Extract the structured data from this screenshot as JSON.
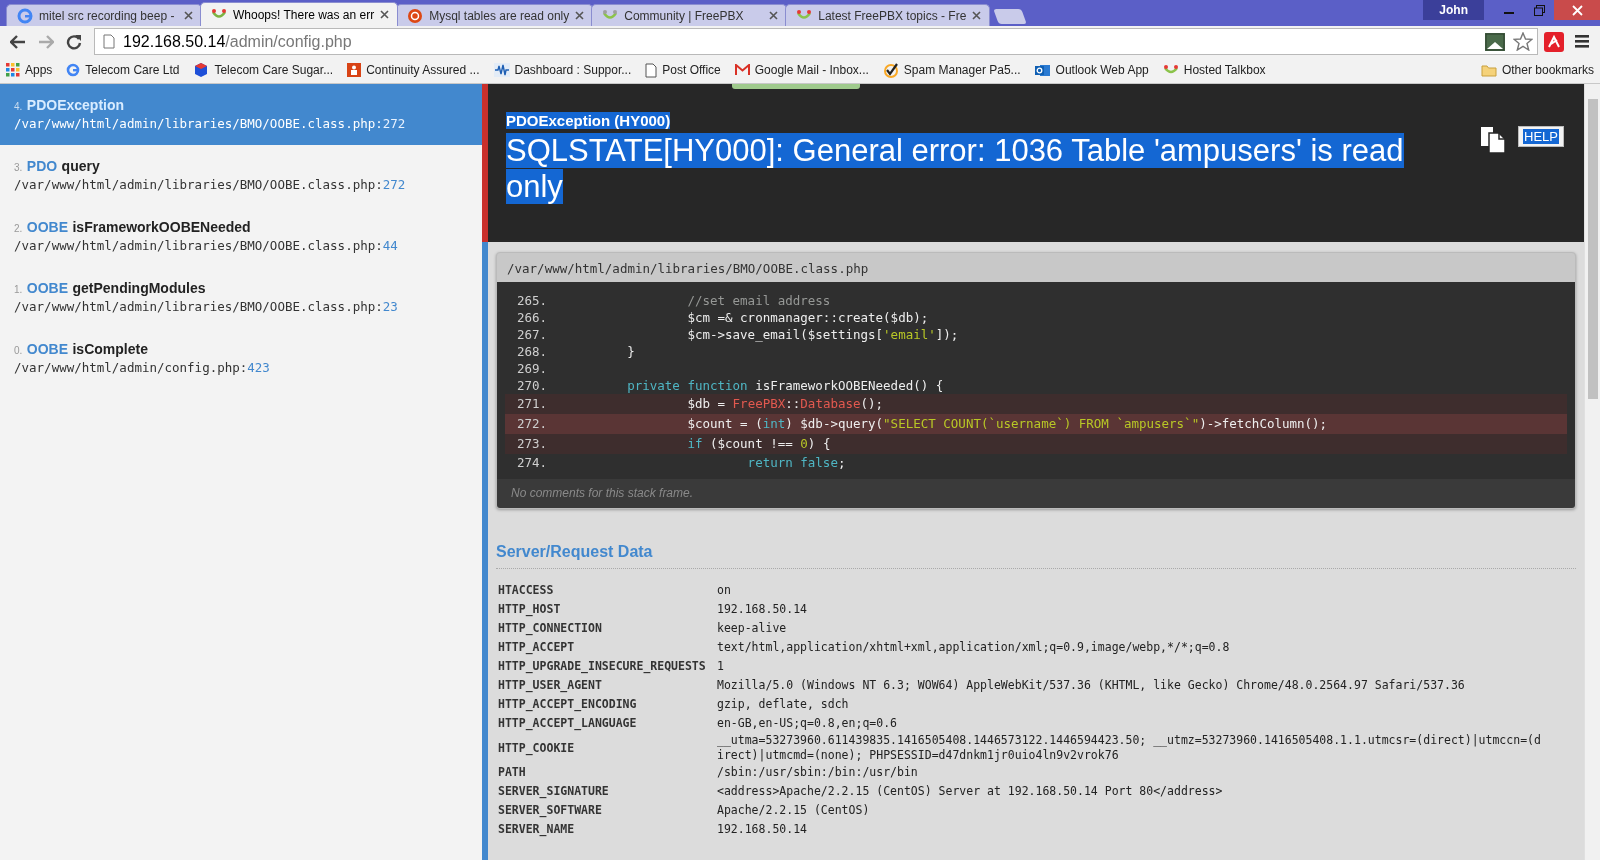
{
  "browser": {
    "tabs": [
      {
        "title": "mitel src recording beep -",
        "selected": false
      },
      {
        "title": "Whoops! There was an err",
        "selected": true
      },
      {
        "title": "Mysql tables are read only",
        "selected": false
      },
      {
        "title": "Community | FreePBX",
        "selected": false
      },
      {
        "title": "Latest FreePBX topics - Fre",
        "selected": false
      }
    ],
    "user": "John",
    "address": {
      "host": "192.168.50.14",
      "path": "/admin/config.php"
    },
    "bookmarks": [
      "Apps",
      "Telecom Care Ltd",
      "Telecom Care Sugar...",
      "Continuity Assured ...",
      "Dashboard : Suppor...",
      "Post Office",
      "Google Mail - Inbox...",
      "Spam Manager Pa5...",
      "Outlook Web App",
      "Hosted Talkbox"
    ],
    "other_bookmarks": "Other bookmarks"
  },
  "frames": [
    {
      "number": "4.",
      "class": "PDOException",
      "file": "/var/www/html/admin/libraries/BMO/OOBE.class.php:",
      "line": "272",
      "selected": true
    },
    {
      "number": "3.",
      "class": "PDO",
      "function": "query",
      "file": "/var/www/html/admin/libraries/BMO/OOBE.class.php:",
      "line": "272",
      "selected": false
    },
    {
      "number": "2.",
      "class": "OOBE",
      "function": "isFrameworkOOBENeeded",
      "file": "/var/www/html/admin/libraries/BMO/OOBE.class.php:",
      "line": "44",
      "selected": false
    },
    {
      "number": "1.",
      "class": "OOBE",
      "function": "getPendingModules",
      "file": "/var/www/html/admin/libraries/BMO/OOBE.class.php:",
      "line": "23",
      "selected": false
    },
    {
      "number": "0.",
      "class": "OOBE",
      "function": "isComplete",
      "file": "/var/www/html/admin/config.php:",
      "line": "423",
      "selected": false
    }
  ],
  "exception": {
    "type": "PDOException (HY000)",
    "message": "SQLSTATE[HY000]: General error: 1036 Table 'ampusers' is read only",
    "help": "HELP"
  },
  "code_frame": {
    "file": "/var/www/html/admin/libraries/BMO/OOBE.class.php",
    "comments": "No comments for this stack frame.",
    "lines": [
      {
        "number": "265.",
        "highlighted": false,
        "selected": false,
        "tokens": [
          {
            "kind": "comment",
            "text": "                //set email address"
          }
        ]
      },
      {
        "number": "266.",
        "highlighted": false,
        "selected": false,
        "tokens": [
          {
            "kind": "plain",
            "text": "                $cm =& cronmanager::create($db);"
          }
        ]
      },
      {
        "number": "267.",
        "highlighted": false,
        "selected": false,
        "tokens": [
          {
            "kind": "plain",
            "text": "                $cm->save_email($settings["
          },
          {
            "kind": "string",
            "text": "'email'"
          },
          {
            "kind": "plain",
            "text": "]);"
          }
        ]
      },
      {
        "number": "268.",
        "highlighted": false,
        "selected": false,
        "tokens": [
          {
            "kind": "plain",
            "text": "        }"
          }
        ]
      },
      {
        "number": "269.",
        "highlighted": false,
        "selected": false
      },
      {
        "number": "270.",
        "highlighted": false,
        "selected": false,
        "tokens": [
          {
            "kind": "keyword",
            "text": "        private function"
          },
          {
            "kind": "plain",
            "text": " isFrameworkOOBENeeded() {"
          }
        ]
      },
      {
        "number": "271.",
        "highlighted": true,
        "selected": false,
        "tokens": [
          {
            "kind": "plain",
            "text": "                $db = "
          },
          {
            "kind": "class",
            "text": "FreePBX"
          },
          {
            "kind": "plain",
            "text": "::"
          },
          {
            "kind": "class",
            "text": "Database"
          },
          {
            "kind": "plain",
            "text": "();"
          }
        ]
      },
      {
        "number": "272.",
        "highlighted": true,
        "selected": true,
        "tokens": [
          {
            "kind": "plain",
            "text": "                $count = ("
          },
          {
            "kind": "keyword",
            "text": "int"
          },
          {
            "kind": "plain",
            "text": ") $db->query("
          },
          {
            "kind": "string",
            "text": "\"SELECT COUNT(`username`) FROM `ampusers`\""
          },
          {
            "kind": "plain",
            "text": ")->fetchColumn();"
          }
        ]
      },
      {
        "number": "273.",
        "highlighted": true,
        "selected": false,
        "tokens": [
          {
            "kind": "keyword",
            "text": "                if"
          },
          {
            "kind": "plain",
            "text": " ($count !== "
          },
          {
            "kind": "number",
            "text": "0"
          },
          {
            "kind": "plain",
            "text": ") {"
          }
        ]
      },
      {
        "number": "274.",
        "highlighted": false,
        "selected": false,
        "tokens": [
          {
            "kind": "keyword",
            "text": "                        return false"
          },
          {
            "kind": "plain",
            "text": ";"
          }
        ]
      }
    ]
  },
  "server_data": {
    "title": "Server/Request Data",
    "rows": [
      {
        "key": "HTACCESS",
        "value": "on"
      },
      {
        "key": "HTTP_HOST",
        "value": "192.168.50.14"
      },
      {
        "key": "HTTP_CONNECTION",
        "value": "keep-alive"
      },
      {
        "key": "HTTP_ACCEPT",
        "value": "text/html,application/xhtml+xml,application/xml;q=0.9,image/webp,*/*;q=0.8"
      },
      {
        "key": "HTTP_UPGRADE_INSECURE_REQUESTS",
        "value": "1"
      },
      {
        "key": "HTTP_USER_AGENT",
        "value": "Mozilla/5.0 (Windows NT 6.3; WOW64) AppleWebKit/537.36 (KHTML, like Gecko) Chrome/48.0.2564.97 Safari/537.36"
      },
      {
        "key": "HTTP_ACCEPT_ENCODING",
        "value": "gzip, deflate, sdch"
      },
      {
        "key": "HTTP_ACCEPT_LANGUAGE",
        "value": "en-GB,en-US;q=0.8,en;q=0.6"
      },
      {
        "key": "HTTP_COOKIE",
        "value": "__utma=53273960.611439835.1416505408.1446573122.1446594423.50; __utmz=53273960.1416505408.1.1.utmcsr=(direct)|utmccn=(direct)|utmcmd=(none); PHPSESSID=d47dnkm1jr0uio4ln9v2vrok76"
      },
      {
        "key": "PATH",
        "value": "/sbin:/usr/sbin:/bin:/usr/bin"
      },
      {
        "key": "SERVER_SIGNATURE",
        "value": "<address>Apache/2.2.15 (CentOS) Server at 192.168.50.14 Port 80</address>"
      },
      {
        "key": "SERVER_SOFTWARE",
        "value": "Apache/2.2.15 (CentOS)"
      },
      {
        "key": "SERVER_NAME",
        "value": "192.168.50.14"
      }
    ]
  }
}
